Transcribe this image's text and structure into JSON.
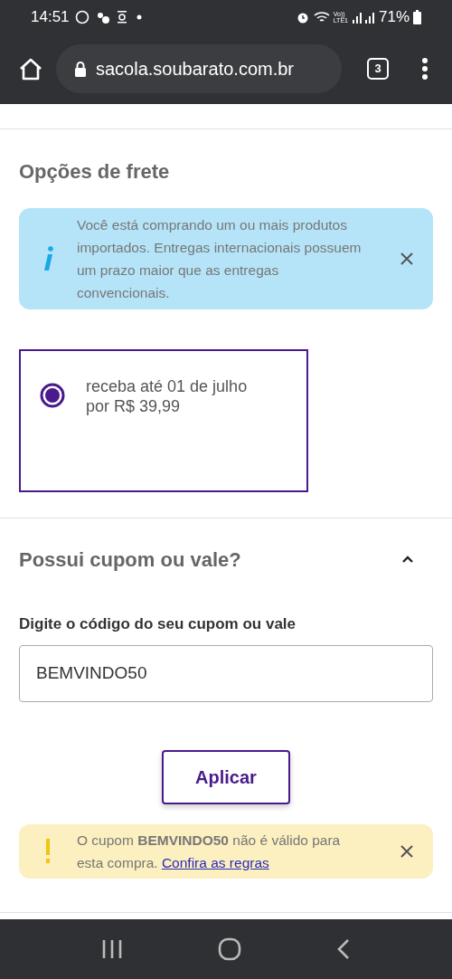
{
  "status_bar": {
    "time": "14:51",
    "volte_top": "Vo))",
    "volte_bottom": "LTE1",
    "battery": "71%"
  },
  "browser": {
    "url": "sacola.soubarato.com.br",
    "tab_count": "3"
  },
  "shipping": {
    "title": "Opções de frete",
    "notice": {
      "kind": "info",
      "text": "Você está comprando um ou mais produtos importados. Entregas internacionais possuem um prazo maior que as entregas convencionais."
    },
    "options": [
      {
        "line_1": "receba até 01 de julho",
        "line_2": "por R$ 39,99",
        "selected": true
      }
    ]
  },
  "coupon": {
    "title": "Possui cupom ou vale?",
    "expanded": true,
    "label": "Digite o código do seu cupom ou vale",
    "value": "BEMVINDO50",
    "button": "Aplicar",
    "notice": {
      "kind": "warning",
      "text": "O cupom **BEMVINDO50** não é válido para esta compra.",
      "link": "Confira as regras"
    }
  }
}
